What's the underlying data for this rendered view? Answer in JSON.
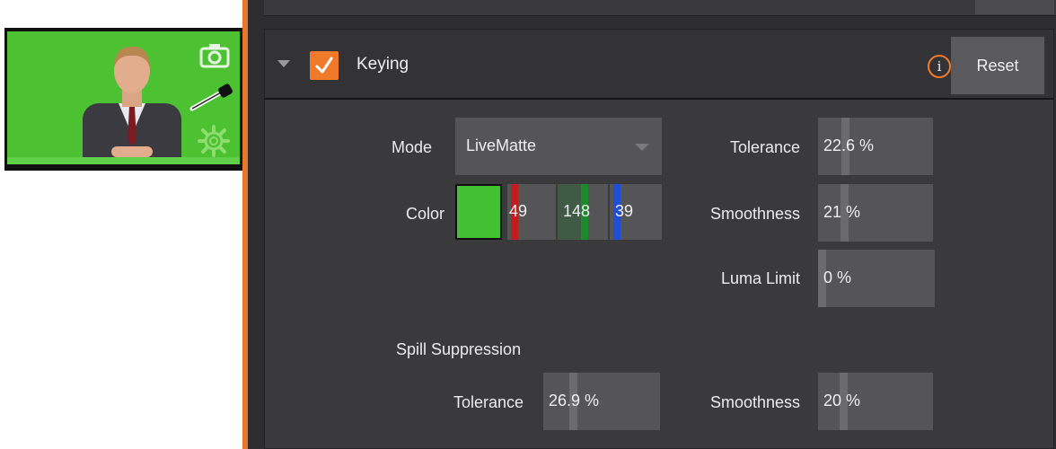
{
  "keying": {
    "title": "Keying",
    "enabled": true,
    "info_icon": "info-icon",
    "reset_label": "Reset",
    "mode": {
      "label": "Mode",
      "value": "LiveMatte"
    },
    "color": {
      "label": "Color",
      "swatch": "#44c033",
      "r": "49",
      "g": "148",
      "b": "39"
    },
    "tolerance": {
      "label": "Tolerance",
      "value": "22.6 %"
    },
    "smoothness": {
      "label": "Smoothness",
      "value": "21 %"
    },
    "luma_limit": {
      "label": "Luma Limit",
      "value": "0 %"
    },
    "spill": {
      "heading": "Spill Suppression",
      "tolerance": {
        "label": "Tolerance",
        "value": "26.9 %"
      },
      "smoothness": {
        "label": "Smoothness",
        "value": "20 %"
      }
    }
  },
  "colors": {
    "accent": "#f07a2a",
    "green_screen": "#4cc232",
    "red_channel": "#c41b1b",
    "green_channel": "#1b8a2a",
    "blue_channel": "#1f4fd6"
  }
}
